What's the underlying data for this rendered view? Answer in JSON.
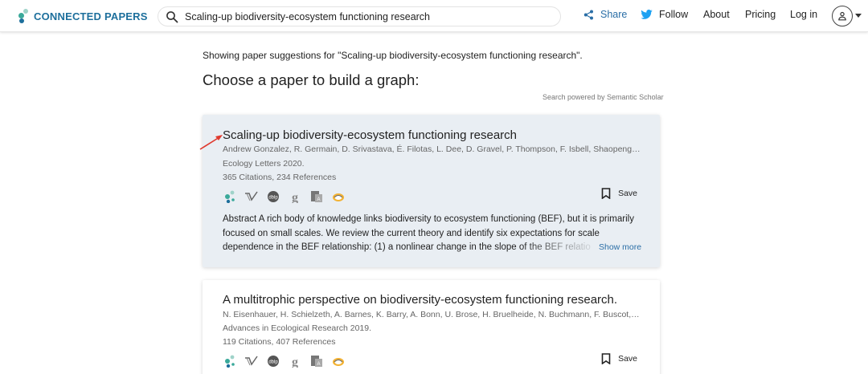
{
  "header": {
    "logo_text": "CONNECTED PAPERS",
    "search_value": "Scaling‐up biodiversity‐ecosystem functioning research",
    "nav": {
      "share": "Share",
      "follow": "Follow",
      "about": "About",
      "pricing": "Pricing",
      "login": "Log in"
    }
  },
  "main": {
    "showing_text": "Showing paper suggestions for \"Scaling‐up biodiversity‐ecosystem functioning research\".",
    "heading": "Choose a paper to build a graph:",
    "powered_by": "Search powered by Semantic Scholar",
    "show_more": "Show more",
    "save_label": "Save",
    "papers": [
      {
        "title": "Scaling‐up biodiversity‐ecosystem functioning research",
        "authors": "Andrew Gonzalez, R. Germain, D. Srivastava, É. Filotas, L. Dee, D. Gravel, P. Thompson, F. Isbell, Shaopeng Wang, S. K...",
        "venue": "Ecology Letters 2020.",
        "citations": "365 Citations, 234 References",
        "abstract_lines": [
          "Abstract A rich body of knowledge links biodiversity to ecosystem functioning (BEF), but it is primarily",
          "focused on small scales. We review the current theory and identify six expectations for scale",
          "dependence in the BEF relationship: (1) a nonlinear change in the slope of the BEF relatio"
        ]
      },
      {
        "title": "A multitrophic perspective on biodiversity-ecosystem functioning research.",
        "authors": "N. Eisenhauer, H. Schielzeth, A. Barnes, K. Barry, A. Bonn, U. Brose, H. Bruelheide, N. Buchmann, F. Buscot, A. Ebeling,...",
        "venue": "Advances in Ecological Research 2019.",
        "citations": "119 Citations, 407 References"
      }
    ]
  },
  "colors": {
    "brand": "#1d6f9c",
    "link": "#2a6ea6",
    "teal": "#3aa99a",
    "selected_card": "#e9eef3",
    "arrow": "#e03a2e"
  },
  "icons": [
    "connected-papers-icon",
    "semantic-scholar-icon",
    "dblp-icon",
    "google-scholar-icon",
    "arxiv-icon",
    "researchgate-icon"
  ]
}
